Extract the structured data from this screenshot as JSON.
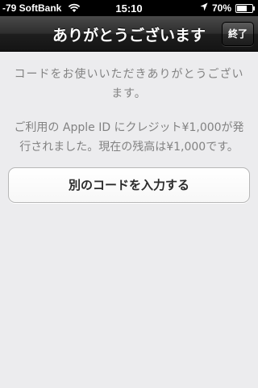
{
  "status_bar": {
    "carrier": "-79 SoftBank",
    "time": "15:10",
    "battery": "70%",
    "battery_level": 0.7,
    "signal_icon": "wifi-icon",
    "location_icon": "location-arrow-icon"
  },
  "nav": {
    "title": "ありがとうございます",
    "done_label": "終了"
  },
  "main": {
    "thanks_message": "コードをお使いいただきありがとうございます。",
    "credit_message": "ご利用の Apple ID にクレジット¥1,000が発行されました。現在の残高は¥1,000です。",
    "enter_code_label": "別のコードを入力する"
  }
}
